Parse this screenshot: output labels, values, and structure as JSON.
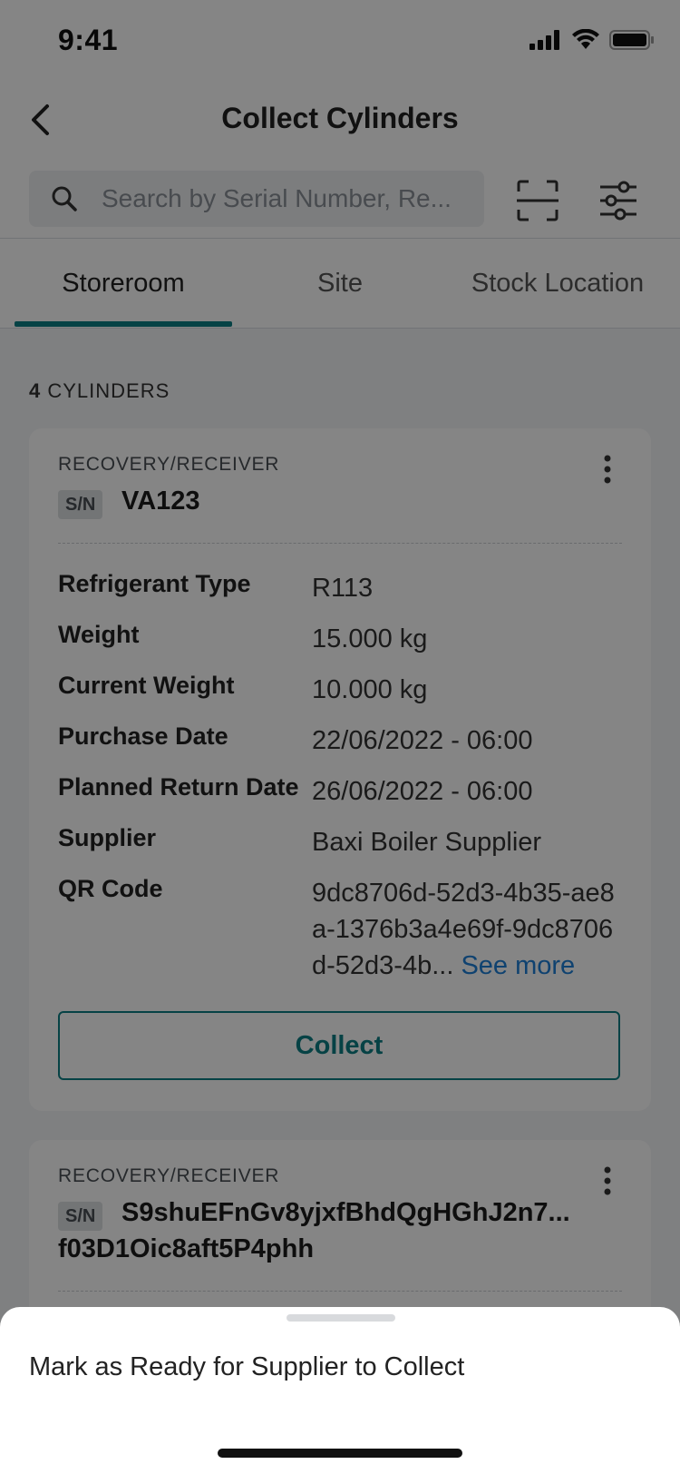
{
  "status_bar": {
    "time": "9:41"
  },
  "header": {
    "title": "Collect Cylinders",
    "search_placeholder": "Search by Serial Number, Re..."
  },
  "tabs": [
    {
      "label": "Storeroom",
      "active": true
    },
    {
      "label": "Site",
      "active": false
    },
    {
      "label": "Stock Location",
      "active": false
    }
  ],
  "list": {
    "count": "4",
    "count_label": "CYLINDERS"
  },
  "cards": [
    {
      "type": "RECOVERY/RECEIVER",
      "sn_badge": "S/N",
      "serial": "VA123",
      "rows": [
        {
          "label": "Refrigerant Type",
          "value": "R113"
        },
        {
          "label": "Weight",
          "value": "15.000 kg"
        },
        {
          "label": "Current Weight",
          "value": "10.000 kg"
        },
        {
          "label": "Purchase Date",
          "value": "22/06/2022 - 06:00"
        },
        {
          "label": "Planned Return Date",
          "value": "26/06/2022 - 06:00"
        },
        {
          "label": "Supplier",
          "value": "Baxi Boiler Supplier"
        },
        {
          "label": "QR Code",
          "value": "9dc8706d-52d3-4b35-ae8a-1376b3a4e69f-9dc8706d-52d3-4b...",
          "link": "See more"
        }
      ],
      "button": "Collect"
    },
    {
      "type": "RECOVERY/RECEIVER",
      "sn_badge": "S/N",
      "serial_line1": "S9shuEFnGv8yjxfBhdQgHGhJ2n7...",
      "serial_line2": "f03D1Oic8aft5P4phh"
    }
  ],
  "sheet": {
    "option": "Mark as Ready for Supplier to Collect"
  },
  "colors": {
    "accent": "#0d7f85",
    "link": "#1e7fd6",
    "overlay": "rgba(0,0,0,0.48)"
  }
}
